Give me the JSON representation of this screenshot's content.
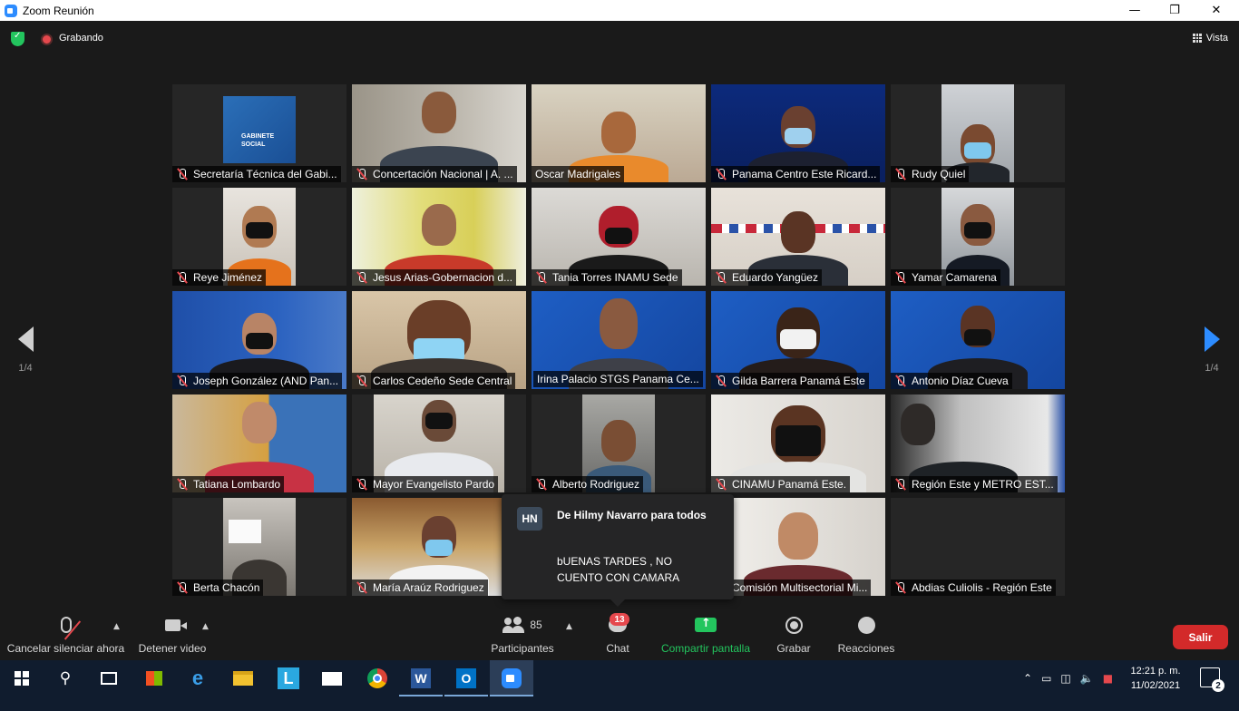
{
  "window": {
    "title": "Zoom Reunión"
  },
  "topbar": {
    "recording_label": "Grabando",
    "view_label": "Vista"
  },
  "pager": {
    "left": "1/4",
    "right": "1/4"
  },
  "participants": [
    "Secretaría Técnica del Gabi...",
    "Concertación Nacional | A. ...",
    "Oscar Madrigales",
    "Panama Centro Este Ricard...",
    "Rudy Quiel",
    "Reye Jiménez",
    "Jesus Arias-Gobernacion d...",
    "Tania Torres INAMU Sede",
    "Eduardo Yangüez",
    "Yamar Camarena",
    "Joseph González (AND Pan...",
    "Carlos Cedeño Sede Central",
    "Irina Palacio STGS  Panama Ce...",
    "Gilda Barrera Panamá Este",
    "Antonio Díaz Cueva",
    "Tatiana Lombardo",
    "Mayor Evangelisto Pardo",
    "Alberto Rodriguez",
    "CINAMU Panamá Este.",
    "Región Este y METRO EST...",
    "Berta Chacón",
    "María Araúz  Rodriguez",
    "",
    "Comisión Multisectorial Mi...",
    "Abdias Culiolis - Región Este"
  ],
  "tile_logo": {
    "line1": "GABINETE",
    "line2": "SOCIAL"
  },
  "chat_popup": {
    "initials": "HN",
    "from": "De Hilmy Navarro para todos",
    "message": "bUENAS TARDES , NO CUENTO CON  CAMARA"
  },
  "toolbar": {
    "mute_label": "Cancelar silenciar ahora",
    "video_label": "Detener video",
    "participants_label": "Participantes",
    "participants_count": "85",
    "chat_label": "Chat",
    "chat_badge": "13",
    "share_label": "Compartir pantalla",
    "record_label": "Grabar",
    "reactions_label": "Reacciones",
    "leave_label": "Salir"
  },
  "taskbar": {
    "time": "12:21 p. m.",
    "date": "11/02/2021",
    "notifications": "2",
    "apps": [
      "start-icon",
      "search-icon",
      "task-view-icon",
      "store-icon",
      "edge-icon",
      "file-explorer-icon",
      "l-app-icon",
      "mail-icon",
      "chrome-icon",
      "word-icon",
      "outlook-icon",
      "zoom-icon"
    ]
  },
  "colors": {
    "accent_blue": "#2d8cff",
    "share_green": "#23c55e",
    "leave_red": "#d32a2a",
    "active_speaker": "#e1e85a"
  }
}
